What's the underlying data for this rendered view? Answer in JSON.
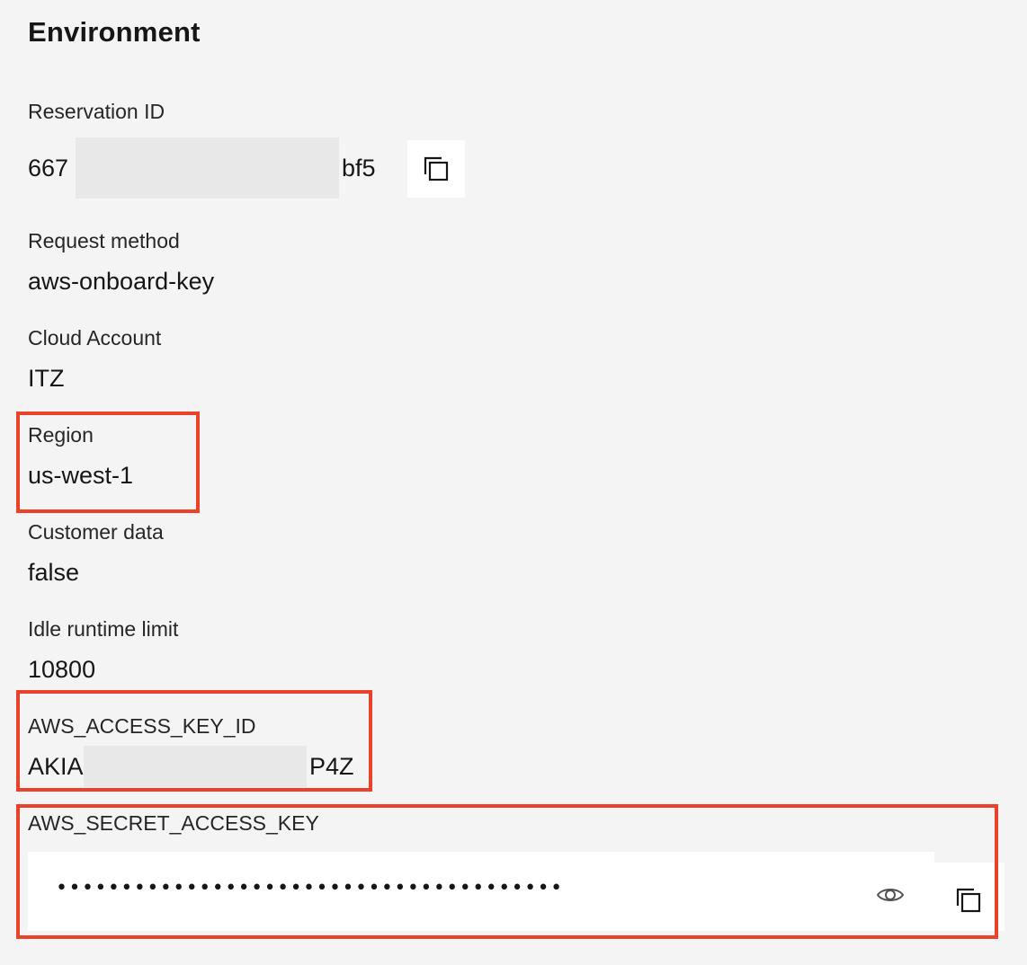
{
  "section": {
    "title": "Environment"
  },
  "fields": {
    "reservation_id": {
      "label": "Reservation ID",
      "value_prefix": "667",
      "value_suffix": "bf5"
    },
    "request_method": {
      "label": "Request method",
      "value": "aws-onboard-key"
    },
    "cloud_account": {
      "label": "Cloud Account",
      "value": "ITZ"
    },
    "region": {
      "label": "Region",
      "value": "us-west-1"
    },
    "customer_data": {
      "label": "Customer data",
      "value": "false"
    },
    "idle_runtime_limit": {
      "label": "Idle runtime limit",
      "value": "10800"
    },
    "aws_access_key_id": {
      "label": "AWS_ACCESS_KEY_ID",
      "value_prefix": "AKIA",
      "value_suffix": "P4Z"
    },
    "aws_secret_access_key": {
      "label": "AWS_SECRET_ACCESS_KEY",
      "masked_value": "•••••••••••••••••••••••••••••••••••••••"
    }
  },
  "icons": {
    "copy": "copy-icon",
    "show_password": "eye-icon"
  },
  "colors": {
    "background": "#f4f4f4",
    "highlight": "#e8432a",
    "text": "#161616"
  }
}
